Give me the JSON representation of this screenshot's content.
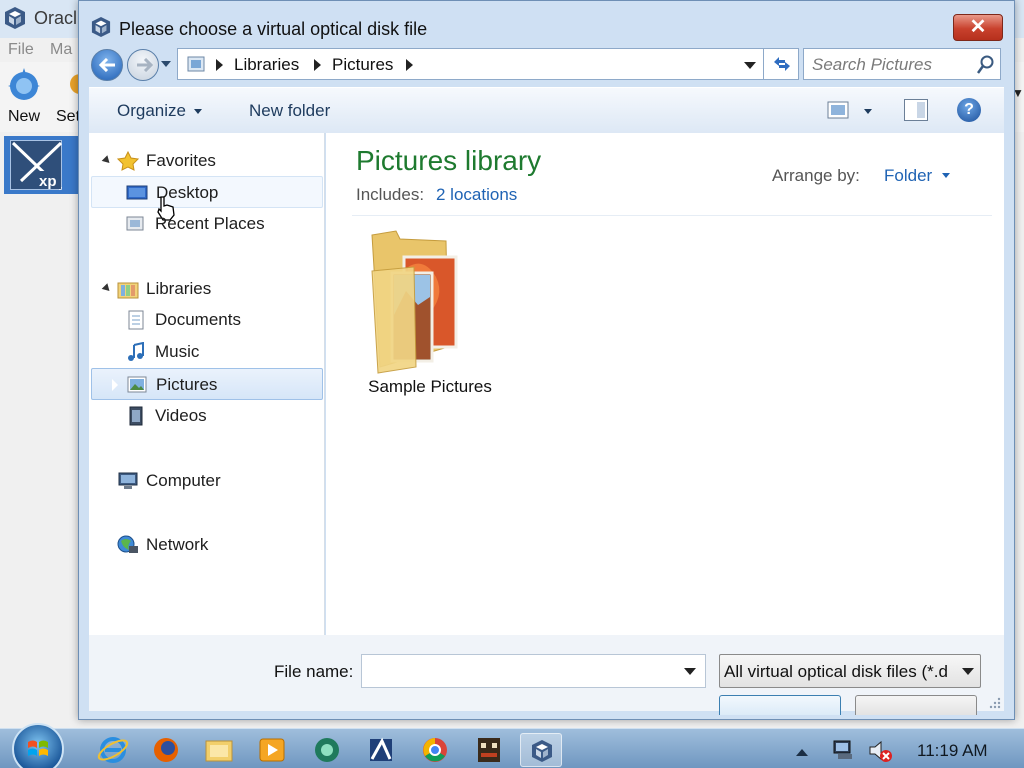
{
  "background_app": {
    "title": "Oracl",
    "menu": [
      "File",
      "Ma"
    ],
    "toolbar": [
      "New",
      "Set"
    ]
  },
  "dialog": {
    "title": "Please choose a virtual optical disk file",
    "close_label": "✕",
    "address": {
      "crumbs": [
        "Libraries",
        "Pictures"
      ]
    },
    "search": {
      "placeholder": "Search Pictures"
    },
    "toolbar": {
      "organize": "Organize",
      "new_folder": "New folder"
    },
    "nav": {
      "favorites": "Favorites",
      "desktop": "Desktop",
      "recent_places": "Recent Places",
      "libraries": "Libraries",
      "documents": "Documents",
      "music": "Music",
      "pictures": "Pictures",
      "videos": "Videos",
      "computer": "Computer",
      "network": "Network"
    },
    "content": {
      "title": "Pictures library",
      "includes_label": "Includes:",
      "includes_link": "2 locations",
      "arrange_label": "Arrange by:",
      "arrange_value": "Folder",
      "items": [
        {
          "label": "Sample Pictures"
        }
      ]
    },
    "bottom": {
      "filename_label": "File name:",
      "filename_value": "",
      "filetype": "All virtual optical disk files (*.d"
    }
  },
  "taskbar": {
    "clock": "11:19 AM"
  },
  "colors": {
    "library_title": "#1e7a2f",
    "link": "#1f63b4",
    "close_button": "#c8412d",
    "selection": "#d6e6f8"
  }
}
